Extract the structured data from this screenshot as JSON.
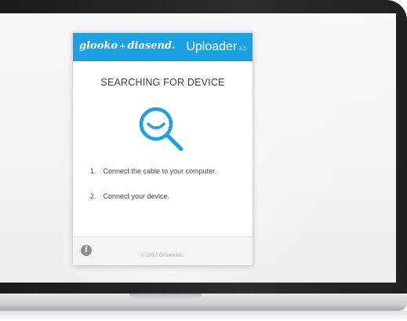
{
  "app": {
    "brand_primary": "glooko",
    "brand_separator": "+",
    "brand_secondary": "diasend.",
    "title": "Uploader",
    "version": "3.1"
  },
  "status": {
    "title": "SEARCHING FOR DEVICE",
    "icon": "magnifier-search-icon"
  },
  "instructions": [
    {
      "number": "1.",
      "text": "Connect the cable to your computer."
    },
    {
      "number": "2.",
      "text": "Connect your device."
    }
  ],
  "footer": {
    "info_icon_glyph": "i",
    "copyright": "© 2017 Glooko Inc."
  },
  "colors": {
    "accent": "#1ea1e3",
    "header_text": "#ffffff",
    "footer_bg": "#f3f3f3"
  }
}
